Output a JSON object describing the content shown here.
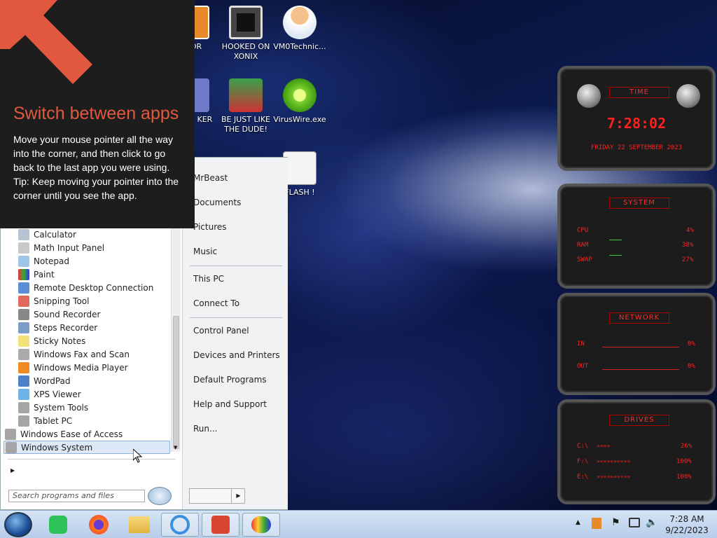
{
  "desktop_icons": [
    {
      "label": "ITOR",
      "icon": "app-icon"
    },
    {
      "label": "HOOKED ON XONIX",
      "icon": "game-icon"
    },
    {
      "label": "VM0Technic...",
      "icon": "doctor-icon"
    },
    {
      "label": "CARD KER",
      "icon": "app-icon"
    },
    {
      "label": "BE JUST LIKE THE DUDE!",
      "icon": "santa-icon"
    },
    {
      "label": "VirusWire.exe",
      "icon": "lime-icon"
    },
    {
      "label": "FLASH !",
      "icon": "flash-icon"
    }
  ],
  "tip": {
    "title": "Switch between apps",
    "body_lines": [
      "Move your mouse pointer all the way into the corner, and then click to go back to the last app you were using.",
      "Tip: Keep moving your pointer into the corner until you see the app."
    ]
  },
  "start_menu": {
    "right_items": [
      "MrBeast",
      "Documents",
      "Pictures",
      "Music",
      "This PC",
      "Connect To",
      "Control Panel",
      "Devices and Printers",
      "Default Programs",
      "Help and Support",
      "Run..."
    ],
    "left_items": [
      "Calculator",
      "Math Input Panel",
      "Notepad",
      "Paint",
      "Remote Desktop Connection",
      "Snipping Tool",
      "Sound Recorder",
      "Steps Recorder",
      "Sticky Notes",
      "Windows Fax and Scan",
      "Windows Media Player",
      "WordPad",
      "XPS Viewer",
      "System Tools",
      "Tablet PC",
      "Windows Ease of Access",
      "Windows System"
    ],
    "search_placeholder": "Search programs and files"
  },
  "gadget": {
    "time_title": "TIME",
    "time": "7:28:02",
    "date": "FRIDAY 22 SEPTEMBER 2023",
    "system_title": "SYSTEM",
    "cpu_label": "CPU",
    "cpu": "4%",
    "ram_label": "RAM",
    "ram": "38%",
    "swap_label": "SWAP",
    "swap": "27%",
    "network_title": "NETWORK",
    "in_label": "IN",
    "in": "0%",
    "out_label": "OUT",
    "out": "0%",
    "drives_title": "DRIVES",
    "c_label": "C:\\",
    "c": "26%",
    "f_label": "F:\\",
    "f": "100%",
    "e_label": "E:\\",
    "e": "100%"
  },
  "taskbar": {
    "time": "7:28 AM",
    "date": "9/22/2023"
  }
}
